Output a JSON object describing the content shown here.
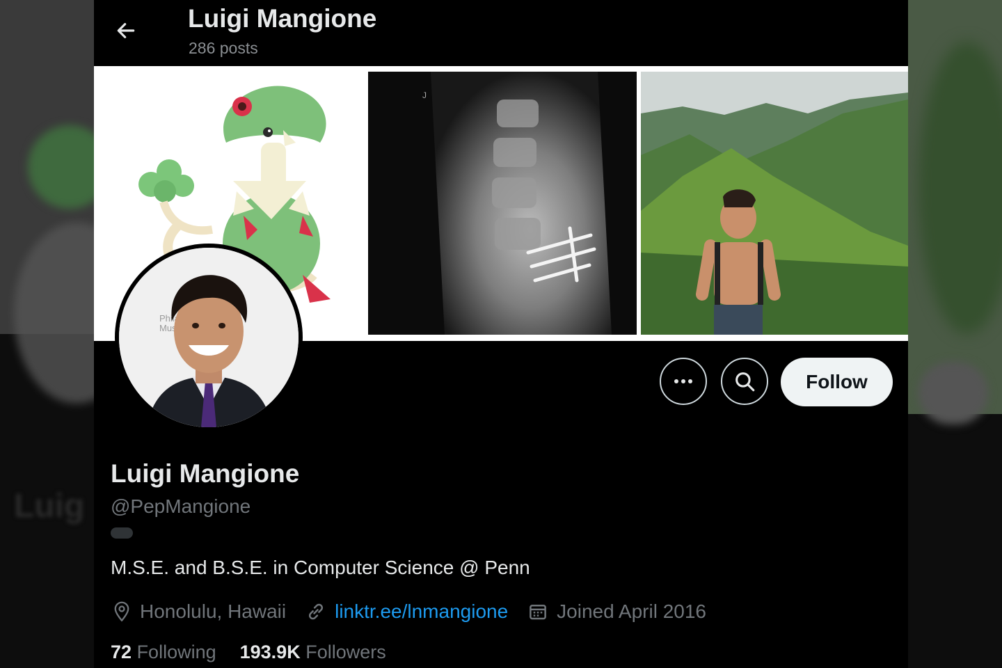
{
  "header": {
    "title": "Luigi Mangione",
    "post_count": "286 posts",
    "back_icon": "arrow-left-icon"
  },
  "profile": {
    "display_name": "Luigi Mangione",
    "handle": "@PepMangione",
    "bio": "M.S.E. and B.S.E. in Computer Science @ Penn",
    "location": "Honolulu, Hawaii",
    "website": "linktr.ee/lnmangione",
    "joined": "Joined April 2016",
    "following_count": "72",
    "following_label": "Following",
    "followers_count": "193.9K",
    "followers_label": "Followers",
    "avatar_backdrop_text": "Philad Muse"
  },
  "actions": {
    "more_icon": "more-icon",
    "search_icon": "search-icon",
    "follow_label": "Follow"
  },
  "colors": {
    "background": "#000000",
    "accent_link": "#1d9bf0",
    "secondary_text": "#71767b",
    "follow_button_bg": "#eff3f4"
  }
}
